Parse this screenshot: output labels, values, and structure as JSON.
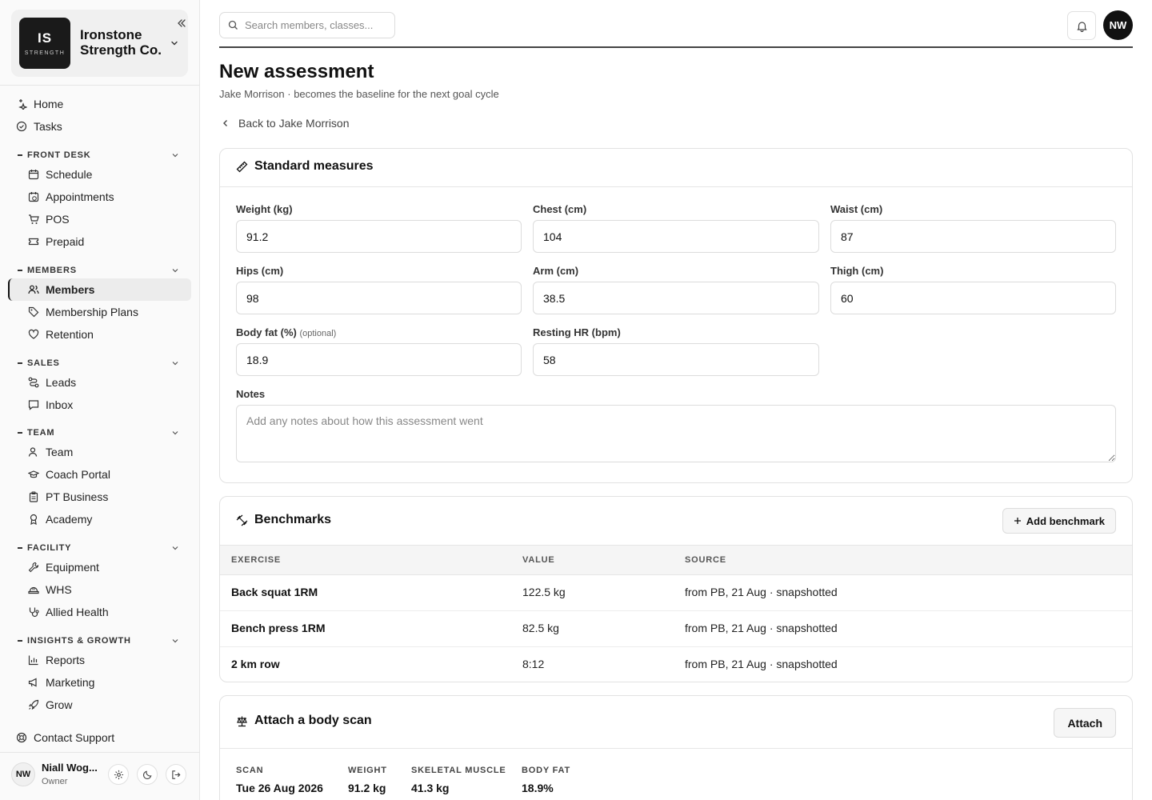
{
  "brand": {
    "initials": "IS",
    "tagline": "STRENGTH",
    "name": "Ironstone Strength Co."
  },
  "nav": {
    "home": "Home",
    "tasks": "Tasks",
    "sections": {
      "front_desk": "FRONT DESK",
      "members": "MEMBERS",
      "sales": "SALES",
      "team": "TEAM",
      "facility": "FACILITY",
      "insights": "INSIGHTS & GROWTH"
    },
    "items": {
      "schedule": "Schedule",
      "appointments": "Appointments",
      "pos": "POS",
      "prepaid": "Prepaid",
      "members": "Members",
      "membership_plans": "Membership Plans",
      "retention": "Retention",
      "leads": "Leads",
      "inbox": "Inbox",
      "team": "Team",
      "coach_portal": "Coach Portal",
      "pt_business": "PT Business",
      "academy": "Academy",
      "equipment": "Equipment",
      "whs": "WHS",
      "allied_health": "Allied Health",
      "reports": "Reports",
      "marketing": "Marketing",
      "grow": "Grow"
    },
    "contact_support": "Contact Support"
  },
  "user": {
    "initials": "NW",
    "name": "Niall Wog...",
    "role": "Owner"
  },
  "topbar": {
    "search_placeholder": "Search members, classes...",
    "avatar_initials": "NW"
  },
  "page": {
    "title": "New assessment",
    "subtitle": "Jake Morrison · becomes the baseline for the next goal cycle",
    "back_label": "Back to Jake Morrison"
  },
  "measures": {
    "title": "Standard measures",
    "weight": {
      "label": "Weight (kg)",
      "value": "91.2"
    },
    "chest": {
      "label": "Chest (cm)",
      "value": "104"
    },
    "waist": {
      "label": "Waist (cm)",
      "value": "87"
    },
    "hips": {
      "label": "Hips (cm)",
      "value": "98"
    },
    "arm": {
      "label": "Arm (cm)",
      "value": "38.5"
    },
    "thigh": {
      "label": "Thigh (cm)",
      "value": "60"
    },
    "body_fat": {
      "label": "Body fat (%)",
      "optional": "(optional)",
      "value": "18.9"
    },
    "resting_hr": {
      "label": "Resting HR (bpm)",
      "value": "58"
    },
    "notes": {
      "label": "Notes",
      "placeholder": "Add any notes about how this assessment went",
      "value": ""
    }
  },
  "benchmarks": {
    "title": "Benchmarks",
    "add_label": "Add benchmark",
    "columns": {
      "exercise": "EXERCISE",
      "value": "VALUE",
      "source": "SOURCE"
    },
    "rows": [
      {
        "exercise": "Back squat 1RM",
        "value": "122.5 kg",
        "source": "from PB, 21 Aug · snapshotted"
      },
      {
        "exercise": "Bench press 1RM",
        "value": "82.5 kg",
        "source": "from PB, 21 Aug · snapshotted"
      },
      {
        "exercise": "2 km row",
        "value": "8:12",
        "source": "from PB, 21 Aug · snapshotted"
      }
    ]
  },
  "body_scan": {
    "title": "Attach a body scan",
    "attach_label": "Attach",
    "columns": {
      "scan": "SCAN",
      "weight": "WEIGHT",
      "skeletal_muscle": "SKELETAL MUSCLE",
      "body_fat": "BODY FAT"
    },
    "row": {
      "scan": "Tue 26 Aug 2026",
      "weight": "91.2 kg",
      "skeletal_muscle": "41.3 kg",
      "body_fat": "18.9%"
    }
  }
}
